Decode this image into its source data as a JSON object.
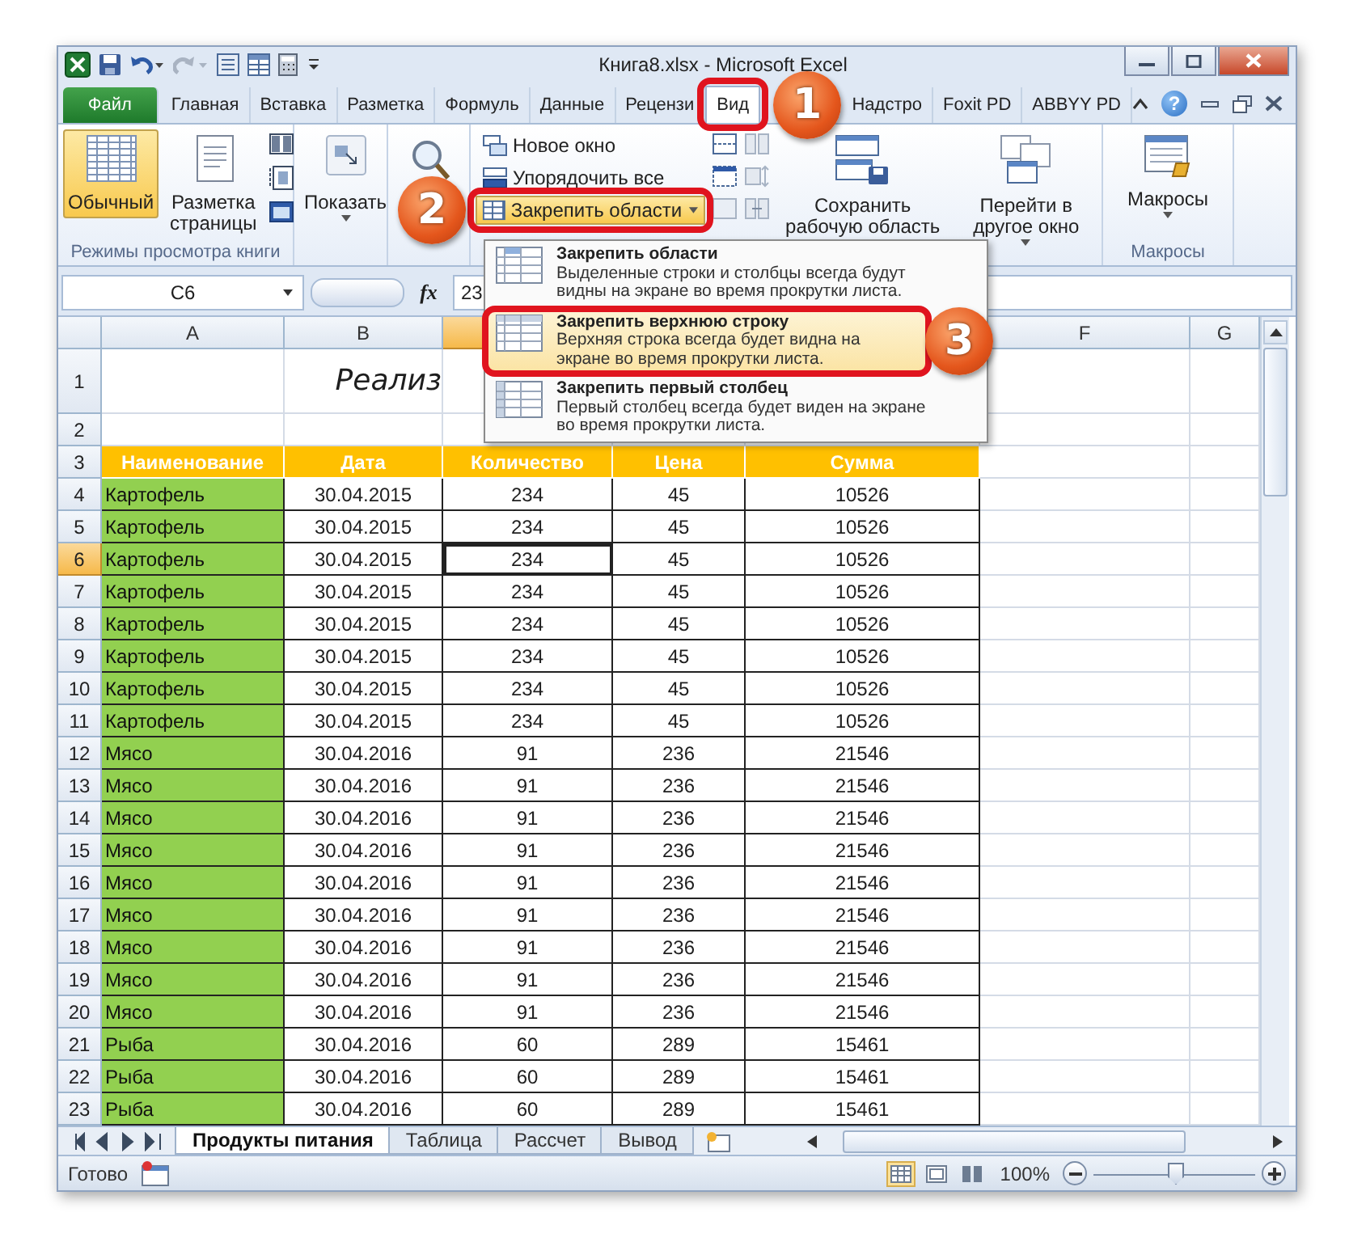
{
  "window": {
    "title": "Книга8.xlsx - Microsoft Excel"
  },
  "ribbon_tabs": [
    {
      "label": "Файл",
      "kind": "file",
      "selected": false
    },
    {
      "label": "Главная",
      "kind": "tab",
      "selected": false
    },
    {
      "label": "Вставка",
      "kind": "tab",
      "selected": false
    },
    {
      "label": "Разметка",
      "kind": "tab",
      "selected": false
    },
    {
      "label": "Формуль",
      "kind": "tab",
      "selected": false
    },
    {
      "label": "Данные",
      "kind": "tab",
      "selected": false
    },
    {
      "label": "Рецензи",
      "kind": "tab",
      "selected": false
    },
    {
      "label": "Вид",
      "kind": "tab",
      "selected": true,
      "callout": "1"
    },
    {
      "label": "Надстро",
      "kind": "tab",
      "selected": false
    },
    {
      "label": "Foxit PD",
      "kind": "tab",
      "selected": false
    },
    {
      "label": "ABBYY PD",
      "kind": "tab",
      "selected": false
    }
  ],
  "help": "?",
  "view_group": {
    "label": "Режимы просмотра книги",
    "buttons": [
      {
        "label": "Обычный",
        "selected": true
      },
      {
        "label": "Разметка страницы",
        "selected": false
      }
    ]
  },
  "show_button": {
    "label": "Показать"
  },
  "window_group": {
    "commands": [
      {
        "label": "Новое окно",
        "selected": false
      },
      {
        "label": "Упорядочить все",
        "selected": false
      },
      {
        "label": "Закрепить области",
        "selected": true,
        "callout": "2"
      }
    ],
    "save_workspace": "Сохранить рабочую область",
    "switch_windows": "Перейти в другое окно"
  },
  "macros_group": {
    "button": "Макросы",
    "label": "Макросы"
  },
  "formula_bar": {
    "name_box": "C6",
    "fx": "fx",
    "value": "23"
  },
  "freeze_menu": {
    "items": [
      {
        "title": "Закрепить области",
        "description": "Выделенные строки и столбцы всегда будут видны на экране во время прокрутки листа.",
        "highlighted": false
      },
      {
        "title": "Закрепить верхнюю строку",
        "description": "Верхняя строка всегда будет видна на экране во время прокрутки листа.",
        "highlighted": true,
        "callout": "3"
      },
      {
        "title": "Закрепить первый столбец",
        "description": "Первый столбец всегда будет виден на экране во время прокрутки листа.",
        "highlighted": false
      }
    ]
  },
  "sheet": {
    "columns": [
      {
        "label": "A",
        "selected": false
      },
      {
        "label": "B",
        "selected": false
      },
      {
        "selected": true
      },
      {},
      {},
      {
        "label": "F",
        "selected": false
      },
      {
        "label": "G",
        "selected": false
      }
    ],
    "rows": [
      {
        "number": "1",
        "kind": "title",
        "selected": false,
        "title": "Реализ"
      },
      {
        "number": "2",
        "kind": "blank",
        "selected": false
      },
      {
        "number": "3",
        "kind": "header",
        "selected": false,
        "cells": [
          "Наименование",
          "Дата",
          "Количество",
          "Цена",
          "Сумма"
        ]
      },
      {
        "number": "4",
        "kind": "data",
        "selected": false,
        "cells": [
          "Картофель",
          "30.04.2015",
          "234",
          "45",
          "10526"
        ]
      },
      {
        "number": "5",
        "kind": "data",
        "selected": false,
        "cells": [
          "Картофель",
          "30.04.2015",
          "234",
          "45",
          "10526"
        ]
      },
      {
        "number": "6",
        "kind": "data",
        "selected": true,
        "cells": [
          "Картофель",
          "30.04.2015",
          "234",
          "45",
          "10526"
        ]
      },
      {
        "number": "7",
        "kind": "data",
        "selected": false,
        "cells": [
          "Картофель",
          "30.04.2015",
          "234",
          "45",
          "10526"
        ]
      },
      {
        "number": "8",
        "kind": "data",
        "selected": false,
        "cells": [
          "Картофель",
          "30.04.2015",
          "234",
          "45",
          "10526"
        ]
      },
      {
        "number": "9",
        "kind": "data",
        "selected": false,
        "cells": [
          "Картофель",
          "30.04.2015",
          "234",
          "45",
          "10526"
        ]
      },
      {
        "number": "10",
        "kind": "data",
        "selected": false,
        "cells": [
          "Картофель",
          "30.04.2015",
          "234",
          "45",
          "10526"
        ]
      },
      {
        "number": "11",
        "kind": "data",
        "selected": false,
        "cells": [
          "Картофель",
          "30.04.2015",
          "234",
          "45",
          "10526"
        ]
      },
      {
        "number": "12",
        "kind": "data",
        "selected": false,
        "cells": [
          "Мясо",
          "30.04.2016",
          "91",
          "236",
          "21546"
        ]
      },
      {
        "number": "13",
        "kind": "data",
        "selected": false,
        "cells": [
          "Мясо",
          "30.04.2016",
          "91",
          "236",
          "21546"
        ]
      },
      {
        "number": "14",
        "kind": "data",
        "selected": false,
        "cells": [
          "Мясо",
          "30.04.2016",
          "91",
          "236",
          "21546"
        ]
      },
      {
        "number": "15",
        "kind": "data",
        "selected": false,
        "cells": [
          "Мясо",
          "30.04.2016",
          "91",
          "236",
          "21546"
        ]
      },
      {
        "number": "16",
        "kind": "data",
        "selected": false,
        "cells": [
          "Мясо",
          "30.04.2016",
          "91",
          "236",
          "21546"
        ]
      },
      {
        "number": "17",
        "kind": "data",
        "selected": false,
        "cells": [
          "Мясо",
          "30.04.2016",
          "91",
          "236",
          "21546"
        ]
      },
      {
        "number": "18",
        "kind": "data",
        "selected": false,
        "cells": [
          "Мясо",
          "30.04.2016",
          "91",
          "236",
          "21546"
        ]
      },
      {
        "number": "19",
        "kind": "data",
        "selected": false,
        "cells": [
          "Мясо",
          "30.04.2016",
          "91",
          "236",
          "21546"
        ]
      },
      {
        "number": "20",
        "kind": "data",
        "selected": false,
        "cells": [
          "Мясо",
          "30.04.2016",
          "91",
          "236",
          "21546"
        ]
      },
      {
        "number": "21",
        "kind": "data",
        "selected": false,
        "cells": [
          "Рыба",
          "30.04.2016",
          "60",
          "289",
          "15461"
        ]
      },
      {
        "number": "22",
        "kind": "data",
        "selected": false,
        "cells": [
          "Рыба",
          "30.04.2016",
          "60",
          "289",
          "15461"
        ]
      },
      {
        "number": "23",
        "kind": "data",
        "selected": false,
        "cells": [
          "Рыба",
          "30.04.2016",
          "60",
          "289",
          "15461"
        ]
      }
    ]
  },
  "sheet_tabs": [
    {
      "label": "Продукты питания",
      "selected": true
    },
    {
      "label": "Таблица",
      "selected": false
    },
    {
      "label": "Рассчет",
      "selected": false
    },
    {
      "label": "Вывод",
      "selected": false
    }
  ],
  "status_bar": {
    "text": "Готово",
    "views": [
      {
        "kind": "normal",
        "selected": true
      },
      {
        "kind": "page_layout",
        "selected": false
      },
      {
        "kind": "page_break",
        "selected": false
      }
    ],
    "zoom": "100%",
    "zoom_slider": {
      "level": 0.5
    }
  }
}
